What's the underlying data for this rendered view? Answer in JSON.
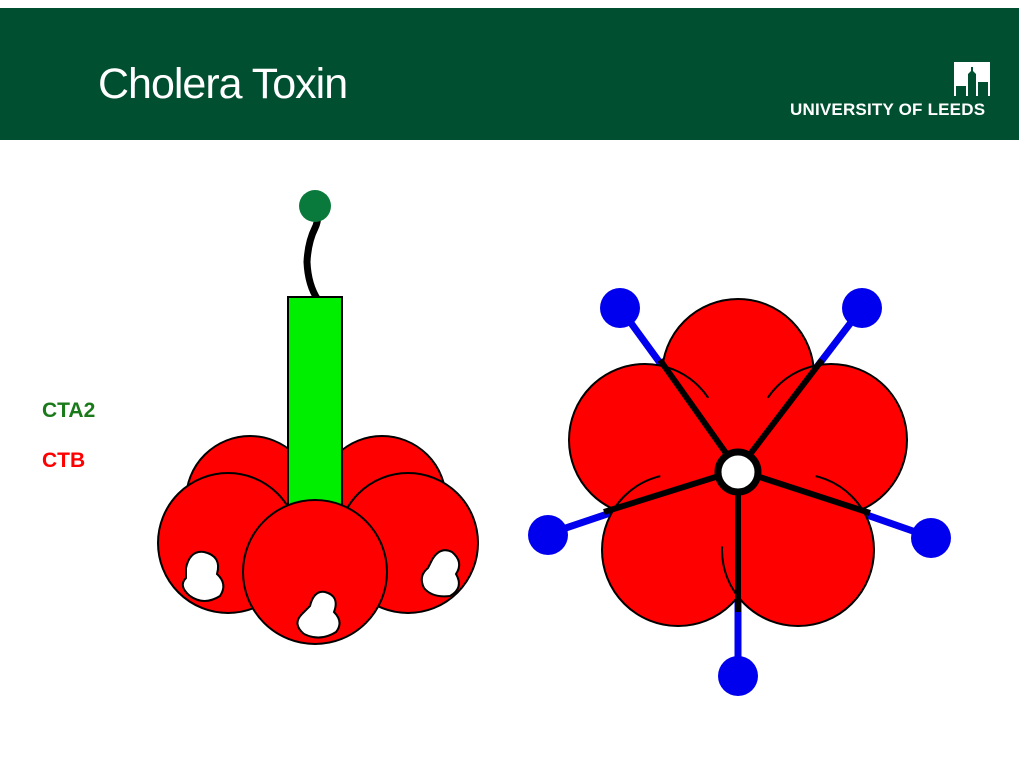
{
  "slide": {
    "title": "Cholera Toxin",
    "institution": "UNIVERSITY OF LEEDS"
  },
  "legend": {
    "items": [
      {
        "label": "CTA2",
        "color": "#1a7a1a"
      },
      {
        "label": "CTB",
        "color": "#ff0000"
      }
    ]
  },
  "colors": {
    "header_bg": "#004f30",
    "cta2_green": "#00ee00",
    "ctb_red": "#ff0000",
    "ligand_blue": "#0000ee",
    "tip_green": "#0a7a3c"
  }
}
